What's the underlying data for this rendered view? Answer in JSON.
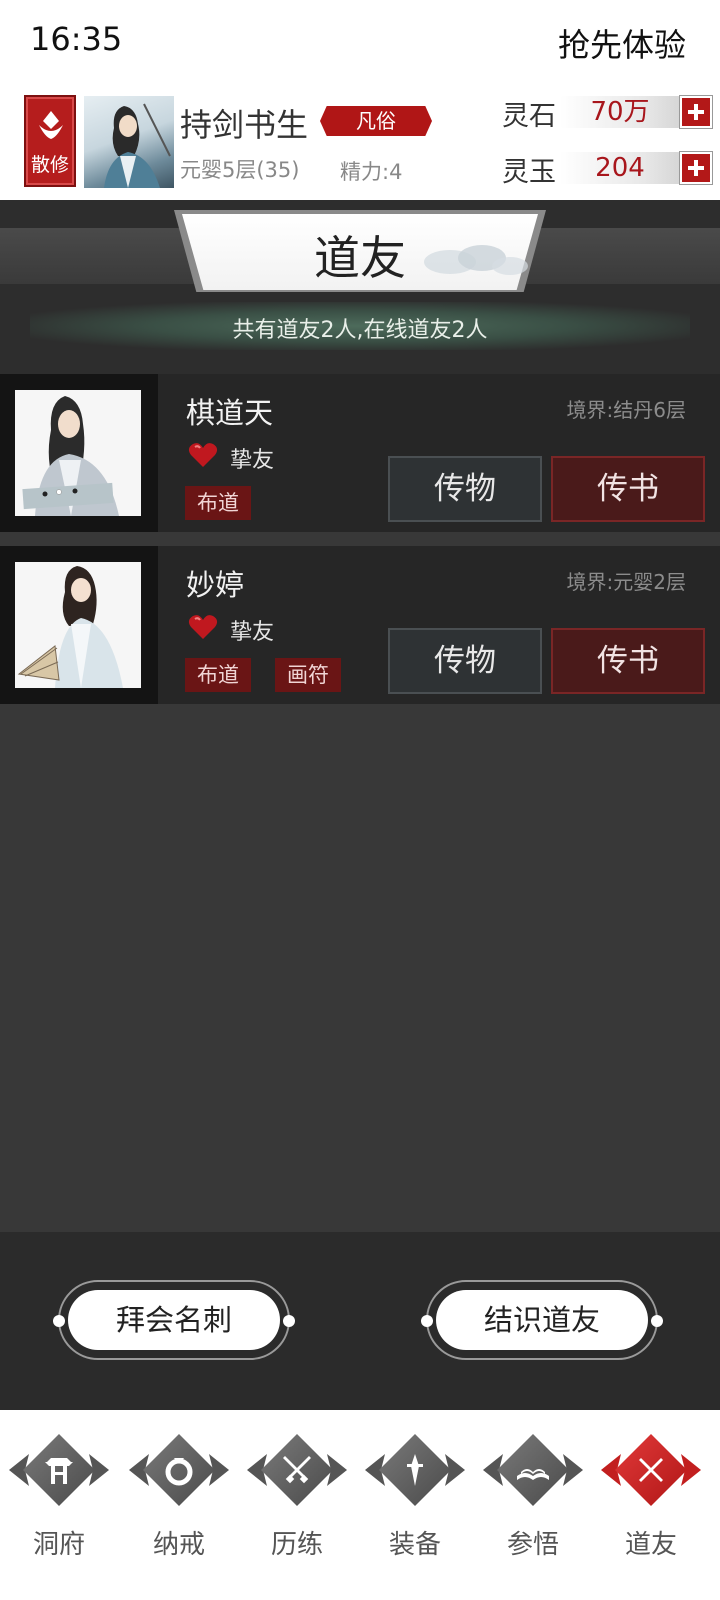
{
  "status_bar": {
    "time": "16:35",
    "right_label": "抢先体验"
  },
  "profile": {
    "sect_label": "散修",
    "name": "持剑书生",
    "rank": "凡俗",
    "level": "元婴5层(35)",
    "energy": "精力:4",
    "currencies": [
      {
        "label": "灵石",
        "value": "70万"
      },
      {
        "label": "灵玉",
        "value": "204"
      }
    ]
  },
  "title": {
    "text": "道友",
    "summary": "共有道友2人,在线道友2人"
  },
  "friends": [
    {
      "name": "棋道天",
      "realm": "境界:结丹6层",
      "relation": "挚友",
      "skills": [
        "布道"
      ],
      "gift_label": "传物",
      "letter_label": "传书"
    },
    {
      "name": "妙婷",
      "realm": "境界:元婴2层",
      "relation": "挚友",
      "skills": [
        "布道",
        "画符"
      ],
      "gift_label": "传物",
      "letter_label": "传书"
    }
  ],
  "actions": {
    "visit_label": "拜会名刺",
    "meet_label": "结识道友"
  },
  "nav": {
    "items": [
      {
        "label": "洞府",
        "icon": "gate-icon"
      },
      {
        "label": "纳戒",
        "icon": "ring-icon"
      },
      {
        "label": "历练",
        "icon": "crossed-swords-icon"
      },
      {
        "label": "装备",
        "icon": "dagger-icon"
      },
      {
        "label": "参悟",
        "icon": "open-book-icon"
      },
      {
        "label": "道友",
        "icon": "close-icon"
      }
    ],
    "active_index": 5
  },
  "colors": {
    "accent_red": "#b01616",
    "background": "#383838",
    "card": "#262626"
  }
}
